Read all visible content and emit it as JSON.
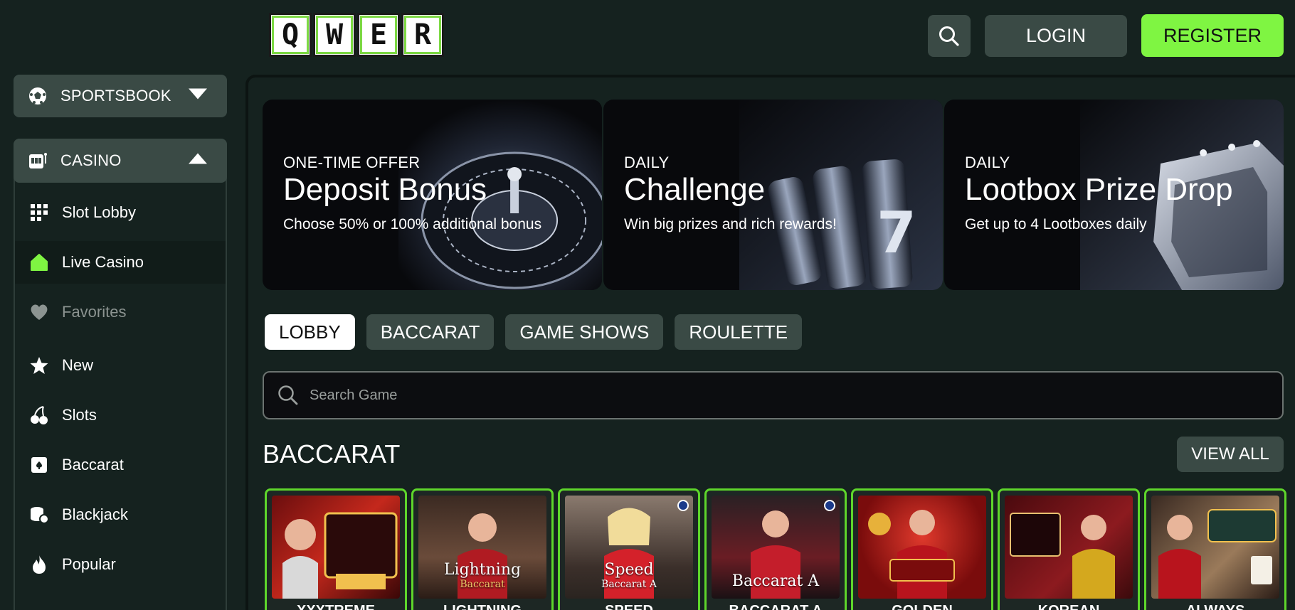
{
  "header": {
    "logo_letters": [
      "Q",
      "W",
      "E",
      "R"
    ],
    "login_label": "LOGIN",
    "register_label": "REGISTER",
    "search_icon": "search-icon",
    "accent_color": "#7ff542"
  },
  "sidebar": {
    "sportsbook": {
      "label": "SPORTSBOOK",
      "icon": "soccer-ball-icon"
    },
    "casino": {
      "label": "CASINO",
      "icon": "slot-machine-icon"
    },
    "items": [
      {
        "label": "Slot Lobby",
        "icon": "grid-icon"
      },
      {
        "label": "Live Casino",
        "icon": "home-icon"
      },
      {
        "label": "Favorites",
        "icon": "heart-icon"
      },
      {
        "label": "New",
        "icon": "star-icon"
      },
      {
        "label": "Slots",
        "icon": "cherries-icon"
      },
      {
        "label": "Baccarat",
        "icon": "playing-card-icon"
      },
      {
        "label": "Blackjack",
        "icon": "chips-icon"
      },
      {
        "label": "Popular",
        "icon": "flame-icon"
      }
    ]
  },
  "banners": [
    {
      "kicker": "ONE-TIME OFFER",
      "title": "Deposit Bonus",
      "desc": "Choose 50% or 100% additional bonus"
    },
    {
      "kicker": "DAILY",
      "title": "Challenge",
      "desc": "Win big prizes and rich rewards!"
    },
    {
      "kicker": "DAILY",
      "title": "Lootbox Prize Drop",
      "desc": "Get up to 4 Lootboxes daily"
    }
  ],
  "tabs": [
    "LOBBY",
    "BACCARAT",
    "GAME SHOWS",
    "ROULETTE"
  ],
  "search": {
    "placeholder": "Search Game"
  },
  "section": {
    "title": "BACCARAT",
    "view_all": "VIEW ALL"
  },
  "games": [
    {
      "name": "XXXTREME",
      "thumb_title": "",
      "thumb_sub": ""
    },
    {
      "name": "LIGHTNING",
      "thumb_title": "Lightning",
      "thumb_sub": "Baccarat"
    },
    {
      "name": "SPEED",
      "thumb_title": "Speed",
      "thumb_sub": "Baccarat A"
    },
    {
      "name": "BACCARAT A",
      "thumb_title": "Baccarat A",
      "thumb_sub": ""
    },
    {
      "name": "GOLDEN",
      "thumb_title": "",
      "thumb_sub": ""
    },
    {
      "name": "KOREAN",
      "thumb_title": "",
      "thumb_sub": ""
    },
    {
      "name": "ALWAYS",
      "thumb_title": "",
      "thumb_sub": ""
    }
  ]
}
